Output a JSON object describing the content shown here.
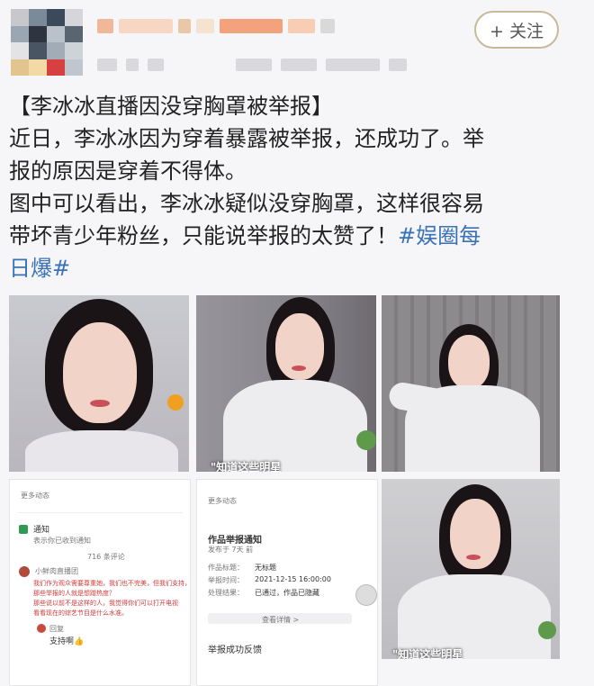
{
  "header": {
    "follow_label": "+ 关注",
    "avatar_colors": [
      "#c8c8cc",
      "#7a8a99",
      "#3b4a5a",
      "#d6d6da",
      "#9aa7b3",
      "#2e3440",
      "#b9c2cb",
      "#5a6572",
      "#e3e3e6",
      "#4a5563",
      "#a1acb7",
      "#ced3d8",
      "#e2c48e",
      "#f2d9a6",
      "#d64040",
      "#bfc6cd"
    ],
    "name_blur_colors": [
      "#f0b898",
      "#f7d7c3",
      "#e8c8a8",
      "#f5e3d2",
      "#f4a27c",
      "#f8cdb4",
      "#d9d9d9"
    ]
  },
  "post": {
    "title": "【李冰冰直播因没穿胸罩被举报】",
    "line1": "近日，李冰冰因为穿着暴露被举报，还成功了。举",
    "line2": "报的原因是穿着不得体。",
    "line3": "图中可以看出，李冰冰疑似没穿胸罩，这样很容易",
    "line4_text": "带坏青少年粉丝，只能说举报的太赞了！",
    "hashtag_part1": "#娱圈每",
    "hashtag_part2": "日爆#"
  },
  "grid": {
    "photos": [
      {
        "name": "photo-1",
        "bg": "#bfc0c4"
      },
      {
        "name": "photo-2",
        "bg": "#8e8c92"
      },
      {
        "name": "photo-3",
        "bg": "#8a878a"
      },
      {
        "name": "photo-4",
        "bg": "#c8c8cb"
      }
    ],
    "watermark": "\"知道这些明星"
  },
  "screenshots": {
    "left": {
      "header_text": "更多动态",
      "notice_title": "通知",
      "notice_subtitle": "表示你已收到通知",
      "count_text": "716 条评论",
      "user_label": "小鲜肉直播团",
      "comment_line1": "我们作为观众需要尊重她，我们也不完美，但我们支持，",
      "comment_line2": "那些举报的人就是想蹭热度？",
      "comment_line3": "那些说以前不是这样的人，我觉得你们可以打开电视",
      "comment_line4": "看看现在的综艺节目是什么水准。",
      "reply_label": "回复",
      "reply_text": "支持啊👍"
    },
    "middle": {
      "header_text": "更多动态",
      "title": "作品举报通知",
      "sub": "发布于 7天 前",
      "row1_label": "作品标题：",
      "row1_value": "无标题",
      "row2_label": "举报时间：",
      "row2_value": "2021-12-15 16:00:00",
      "row3_label": "处理结果：",
      "row3_value": "已通过，作品已隐藏",
      "link_text": "查看详情 >",
      "footer": "举报成功反馈"
    }
  }
}
